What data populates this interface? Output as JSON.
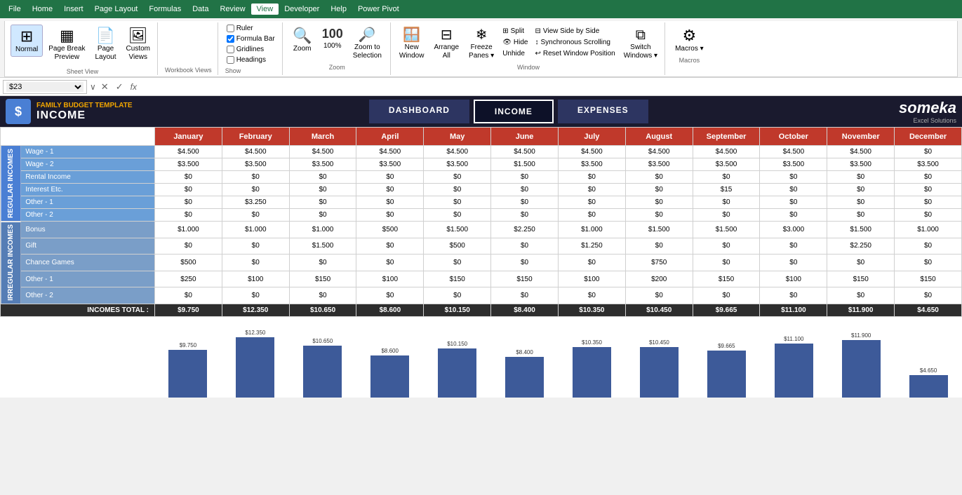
{
  "menubar": {
    "items": [
      "File",
      "Home",
      "Insert",
      "Page Layout",
      "Formulas",
      "Data",
      "Review",
      "View",
      "Developer",
      "Help",
      "Power Pivot"
    ]
  },
  "ribbon": {
    "active_tab": "View",
    "tabs": [
      "File",
      "Home",
      "Insert",
      "Page Layout",
      "Formulas",
      "Data",
      "Review",
      "View",
      "Developer",
      "Help",
      "Power Pivot"
    ],
    "sheet_view_group": {
      "label": "Sheet View",
      "buttons": [
        "Normal",
        "Page Break Preview",
        "Page Layout",
        "Custom Views"
      ],
      "name_box_value": "$23"
    },
    "workbook_views_label": "Workbook Views",
    "show": {
      "label": "Show",
      "ruler": "Ruler",
      "gridlines": "Gridlines",
      "formula_bar": "Formula Bar",
      "headings": "Headings"
    },
    "zoom": {
      "label": "Zoom",
      "zoom_btn": "Zoom",
      "zoom_100": "100%",
      "zoom_selection": "Zoom to Selection"
    },
    "window": {
      "label": "Window",
      "new_window": "New Window",
      "arrange_all": "Arrange All",
      "freeze_panes": "Freeze Panes",
      "split": "Split",
      "hide": "Hide",
      "unhide": "Unhide",
      "view_side_by_side": "View Side by Side",
      "synchronous_scrolling": "Synchronous Scrolling",
      "reset_window_position": "Reset Window Position",
      "switch_windows": "Switch Windows"
    },
    "macros": {
      "label": "Macros",
      "btn": "Macros"
    }
  },
  "formula_bar": {
    "name_box": "$23",
    "formula": ""
  },
  "sheet": {
    "title": "INCOME",
    "subtitle": "FAMILY BUDGET TEMPLATE",
    "nav": {
      "dashboard": "DASHBOARD",
      "income": "INCOME",
      "expenses": "EXPENSES"
    },
    "logo": "someka",
    "logo_sub": "Excel Solutions"
  },
  "table": {
    "months": [
      "January",
      "February",
      "March",
      "April",
      "May",
      "June",
      "July",
      "August",
      "September",
      "October",
      "November",
      "December"
    ],
    "regular_incomes_label": "REGULAR INCOMES",
    "irregular_incomes_label": "IRREGULAR INCOMES",
    "regular_rows": [
      {
        "label": "Wage - 1",
        "values": [
          "$4.500",
          "$4.500",
          "$4.500",
          "$4.500",
          "$4.500",
          "$4.500",
          "$4.500",
          "$4.500",
          "$4.500",
          "$4.500",
          "$4.500",
          "$0"
        ]
      },
      {
        "label": "Wage - 2",
        "values": [
          "$3.500",
          "$3.500",
          "$3.500",
          "$3.500",
          "$3.500",
          "$1.500",
          "$3.500",
          "$3.500",
          "$3.500",
          "$3.500",
          "$3.500",
          "$3.500"
        ]
      },
      {
        "label": "Rental Income",
        "values": [
          "$0",
          "$0",
          "$0",
          "$0",
          "$0",
          "$0",
          "$0",
          "$0",
          "$0",
          "$0",
          "$0",
          "$0"
        ]
      },
      {
        "label": "Interest Etc.",
        "values": [
          "$0",
          "$0",
          "$0",
          "$0",
          "$0",
          "$0",
          "$0",
          "$0",
          "$15",
          "$0",
          "$0",
          "$0"
        ]
      },
      {
        "label": "Other - 1",
        "values": [
          "$0",
          "$3.250",
          "$0",
          "$0",
          "$0",
          "$0",
          "$0",
          "$0",
          "$0",
          "$0",
          "$0",
          "$0"
        ]
      },
      {
        "label": "Other - 2",
        "values": [
          "$0",
          "$0",
          "$0",
          "$0",
          "$0",
          "$0",
          "$0",
          "$0",
          "$0",
          "$0",
          "$0",
          "$0"
        ]
      }
    ],
    "irregular_rows": [
      {
        "label": "Bonus",
        "values": [
          "$1.000",
          "$1.000",
          "$1.000",
          "$500",
          "$1.500",
          "$2.250",
          "$1.000",
          "$1.500",
          "$1.500",
          "$3.000",
          "$1.500",
          "$1.000"
        ]
      },
      {
        "label": "Gift",
        "values": [
          "$0",
          "$0",
          "$1.500",
          "$0",
          "$500",
          "$0",
          "$1.250",
          "$0",
          "$0",
          "$0",
          "$2.250",
          "$0"
        ]
      },
      {
        "label": "Chance Games",
        "values": [
          "$500",
          "$0",
          "$0",
          "$0",
          "$0",
          "$0",
          "$0",
          "$750",
          "$0",
          "$0",
          "$0",
          "$0"
        ]
      },
      {
        "label": "Other - 1",
        "values": [
          "$250",
          "$100",
          "$150",
          "$100",
          "$150",
          "$150",
          "$100",
          "$200",
          "$150",
          "$100",
          "$150",
          "$150"
        ]
      },
      {
        "label": "Other - 2",
        "values": [
          "$0",
          "$0",
          "$0",
          "$0",
          "$0",
          "$0",
          "$0",
          "$0",
          "$0",
          "$0",
          "$0",
          "$0"
        ]
      }
    ],
    "totals_label": "INCOMES TOTAL :",
    "totals": [
      "$9.750",
      "$12.350",
      "$10.650",
      "$8.600",
      "$10.150",
      "$8.400",
      "$10.350",
      "$10.450",
      "$9.665",
      "$11.100",
      "$11.900",
      "$4.650"
    ]
  },
  "chart": {
    "bars": [
      {
        "label": "$9.750",
        "value": 9750
      },
      {
        "label": "$12.350",
        "value": 12350
      },
      {
        "label": "$10.650",
        "value": 10650
      },
      {
        "label": "$8.600",
        "value": 8600
      },
      {
        "label": "$10.150",
        "value": 10150
      },
      {
        "label": "$8.400",
        "value": 8400
      },
      {
        "label": "$10.350",
        "value": 10350
      },
      {
        "label": "$10.450",
        "value": 10450
      },
      {
        "label": "$9.665",
        "value": 9665
      },
      {
        "label": "$11.100",
        "value": 11100
      },
      {
        "label": "$11.900",
        "value": 11900
      },
      {
        "label": "$4.650",
        "value": 4650
      }
    ],
    "max_value": 13000
  }
}
